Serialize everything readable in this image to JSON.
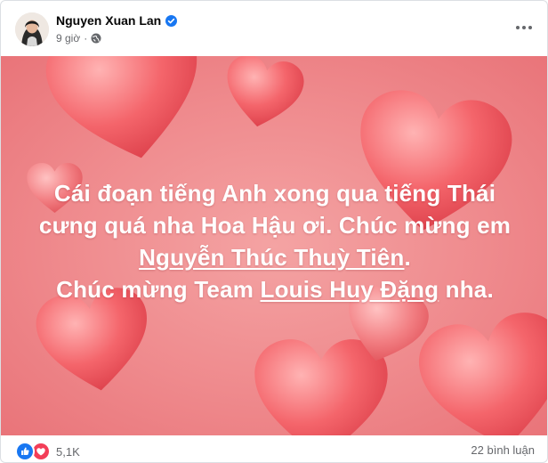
{
  "post": {
    "author": "Nguyen Xuan Lan",
    "time": "9 giờ",
    "separator": "·"
  },
  "card": {
    "line1": "Cái đoạn tiếng Anh xong qua tiếng Thái",
    "line2": "cưng quá nha Hoa Hậu ơi. Chúc mừng em",
    "line3_link": "Nguyễn Thúc Thuỳ Tiên",
    "line3_after": ".",
    "line4_before": "Chúc mừng Team ",
    "line4_link": "Louis Huy Đặng",
    "line4_after": " nha."
  },
  "footer": {
    "reaction_count": "5,1K",
    "comment_count": "22 bình luận"
  },
  "colors": {
    "background_start": "#f4a3a3",
    "background_end": "#e97479",
    "like_blue": "#1877f2",
    "love_red": "#f33e58"
  },
  "icons": [
    "verified-badge-icon",
    "globe-icon",
    "more-options-icon",
    "like-reaction-icon",
    "love-reaction-icon"
  ]
}
